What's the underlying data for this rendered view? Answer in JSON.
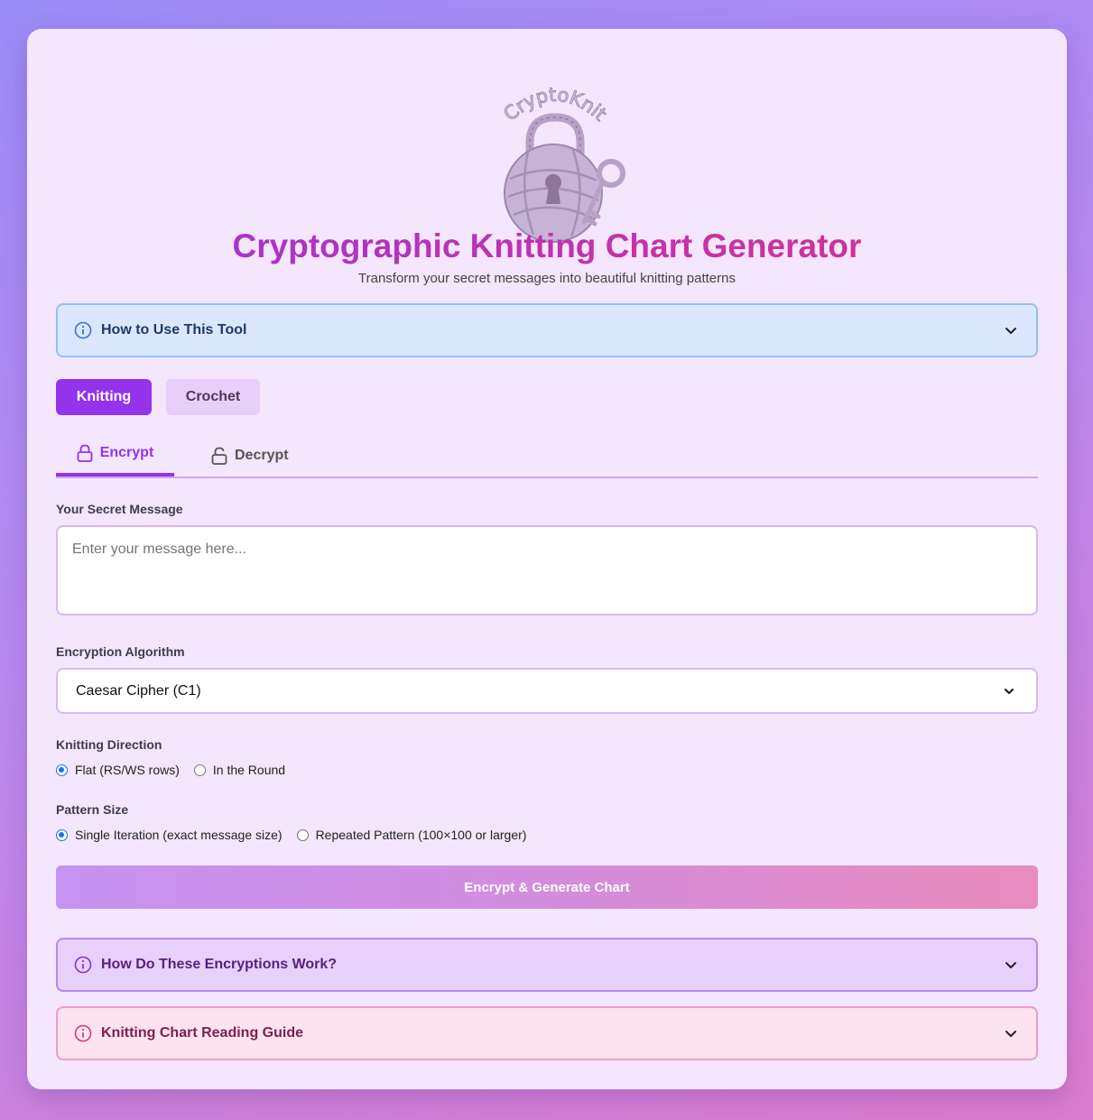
{
  "logo": {
    "text": "CryptoKnit",
    "icon": "yarn-padlock-icon"
  },
  "header": {
    "title": "Cryptographic Knitting Chart Generator",
    "subtitle": "Transform your secret messages into beautiful knitting patterns"
  },
  "how_to_use": {
    "label": "How to Use This Tool",
    "icon": "info-icon",
    "color": "#1f3a66"
  },
  "craft_toggle": {
    "knitting": "Knitting",
    "crochet": "Crochet",
    "selected": "Knitting",
    "accent": "#9333ea"
  },
  "mode_tabs": {
    "encrypt": "Encrypt",
    "decrypt": "Decrypt",
    "selected": "Encrypt"
  },
  "message": {
    "label": "Your Secret Message",
    "placeholder": "Enter your message here...",
    "value": ""
  },
  "algorithm": {
    "label": "Encryption Algorithm",
    "selected": "Caesar Cipher (C1)"
  },
  "direction": {
    "label": "Knitting Direction",
    "options": [
      "Flat (RS/WS rows)",
      "In the Round"
    ],
    "selected": "Flat (RS/WS rows)"
  },
  "pattern_size": {
    "label": "Pattern Size",
    "options": [
      "Single Iteration (exact message size)",
      "Repeated Pattern (100×100 or larger)"
    ],
    "selected": "Single Iteration (exact message size)"
  },
  "submit": {
    "label": "Encrypt & Generate Chart"
  },
  "how_encryptions_work": {
    "label": "How Do These Encryptions Work?",
    "color": "#5a1f7d"
  },
  "reading_guide": {
    "label": "Knitting Chart Reading Guide",
    "color": "#7d1f50"
  }
}
